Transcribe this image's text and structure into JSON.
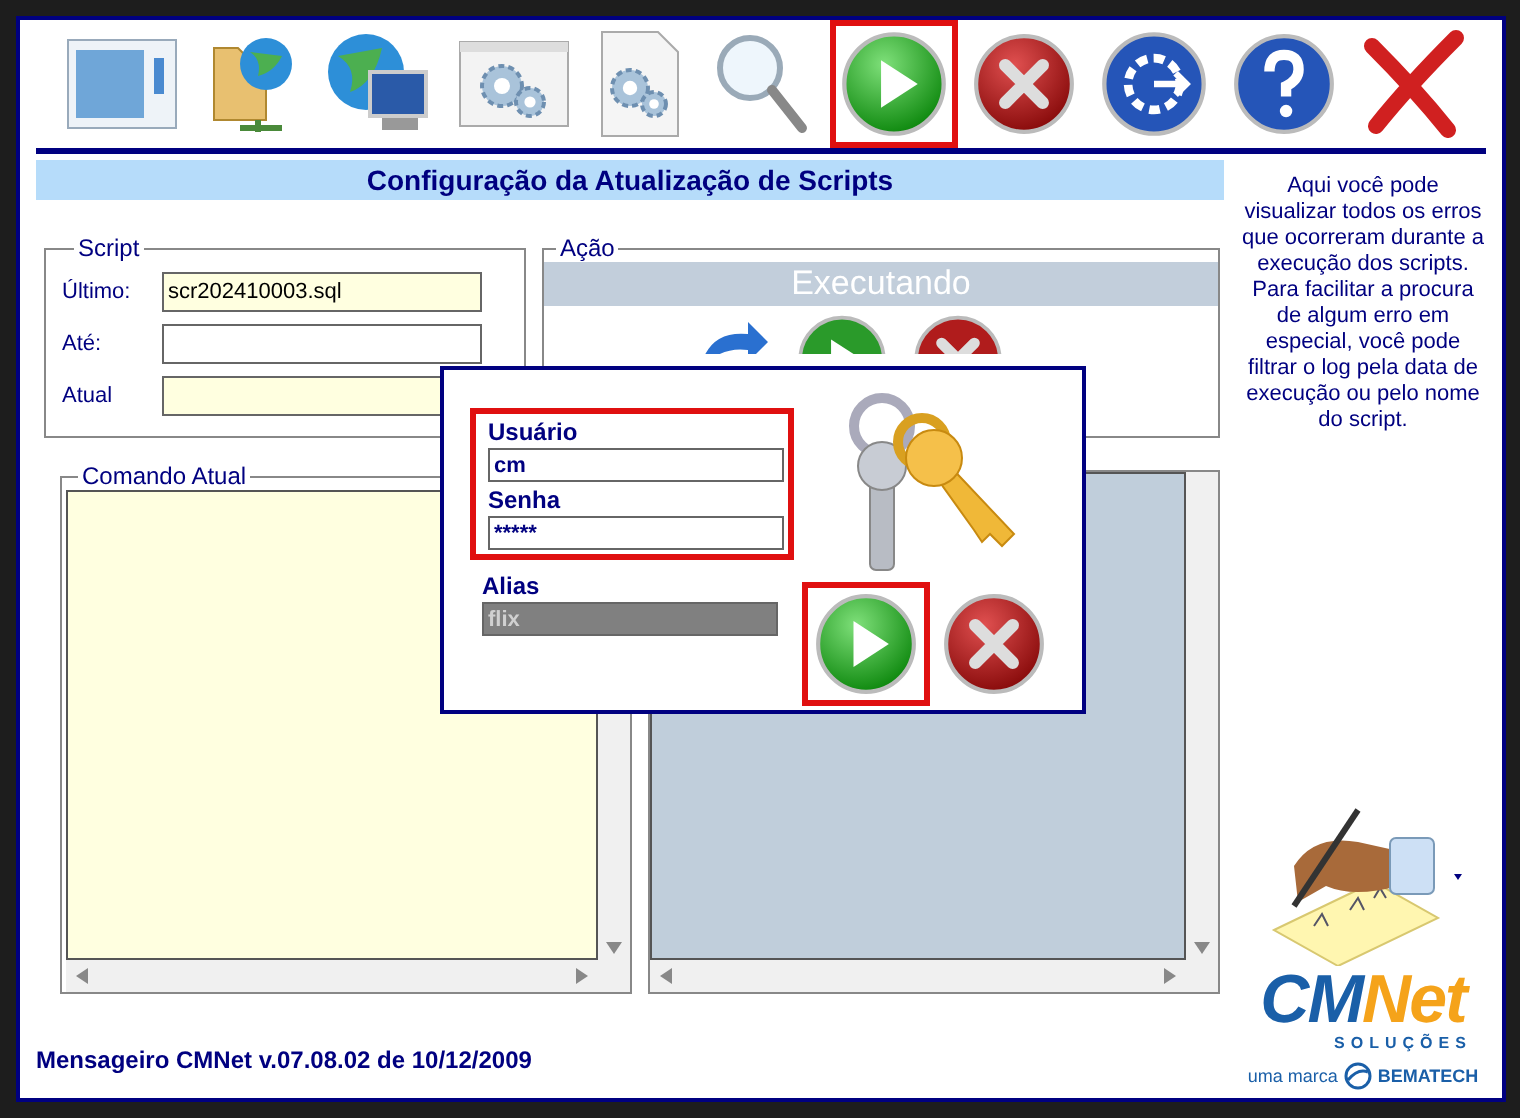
{
  "toolbar": [
    {
      "kind": "window",
      "highlighted": false
    },
    {
      "kind": "folder-globe",
      "highlighted": false
    },
    {
      "kind": "globe-monitor",
      "highlighted": false
    },
    {
      "kind": "gear-window",
      "highlighted": false
    },
    {
      "kind": "gear-document",
      "highlighted": false
    },
    {
      "kind": "search",
      "highlighted": false
    },
    {
      "kind": "play",
      "highlighted": true
    },
    {
      "kind": "cancel",
      "highlighted": false
    },
    {
      "kind": "restore",
      "highlighted": false
    },
    {
      "kind": "help",
      "highlighted": false
    },
    {
      "kind": "close",
      "highlighted": false
    }
  ],
  "header": {
    "title": "Configuração da Atualização de Scripts"
  },
  "script_group": {
    "legend": "Script",
    "fields": [
      {
        "label": "Último:",
        "value": "scr202410003.sql",
        "kind": "yellow"
      },
      {
        "label": "Até:",
        "kind": "white"
      },
      {
        "label": "Atual",
        "kind": "yellow"
      }
    ]
  },
  "action_group": {
    "legend": "Ação",
    "status": "Executando"
  },
  "command_panel": {
    "legend": "Comando Atual"
  },
  "help_text": "Aqui você pode visualizar todos os erros que ocorreram durante a execução dos scripts. Para facilitar a procura de algum erro em especial, você pode filtrar o log pela data de execução ou pelo nome do script.",
  "footer": "Mensageiro CMNet v.07.08.02 de 10/12/2009",
  "logo": {
    "name_first": "CM",
    "name_second": "Net",
    "tagline": "SOLUÇÕES",
    "brand_note": "uma marca",
    "brand": "BEMATECH"
  },
  "login_dialog": {
    "fields": [
      {
        "label": "Usuário",
        "value": "cm",
        "disabled": false,
        "highlighted": true
      },
      {
        "label": "Senha",
        "value": "*****",
        "disabled": false,
        "highlighted": true
      },
      {
        "label": "Alias",
        "value": "flix",
        "disabled": true,
        "highlighted": false
      }
    ],
    "confirm_highlighted": true
  }
}
